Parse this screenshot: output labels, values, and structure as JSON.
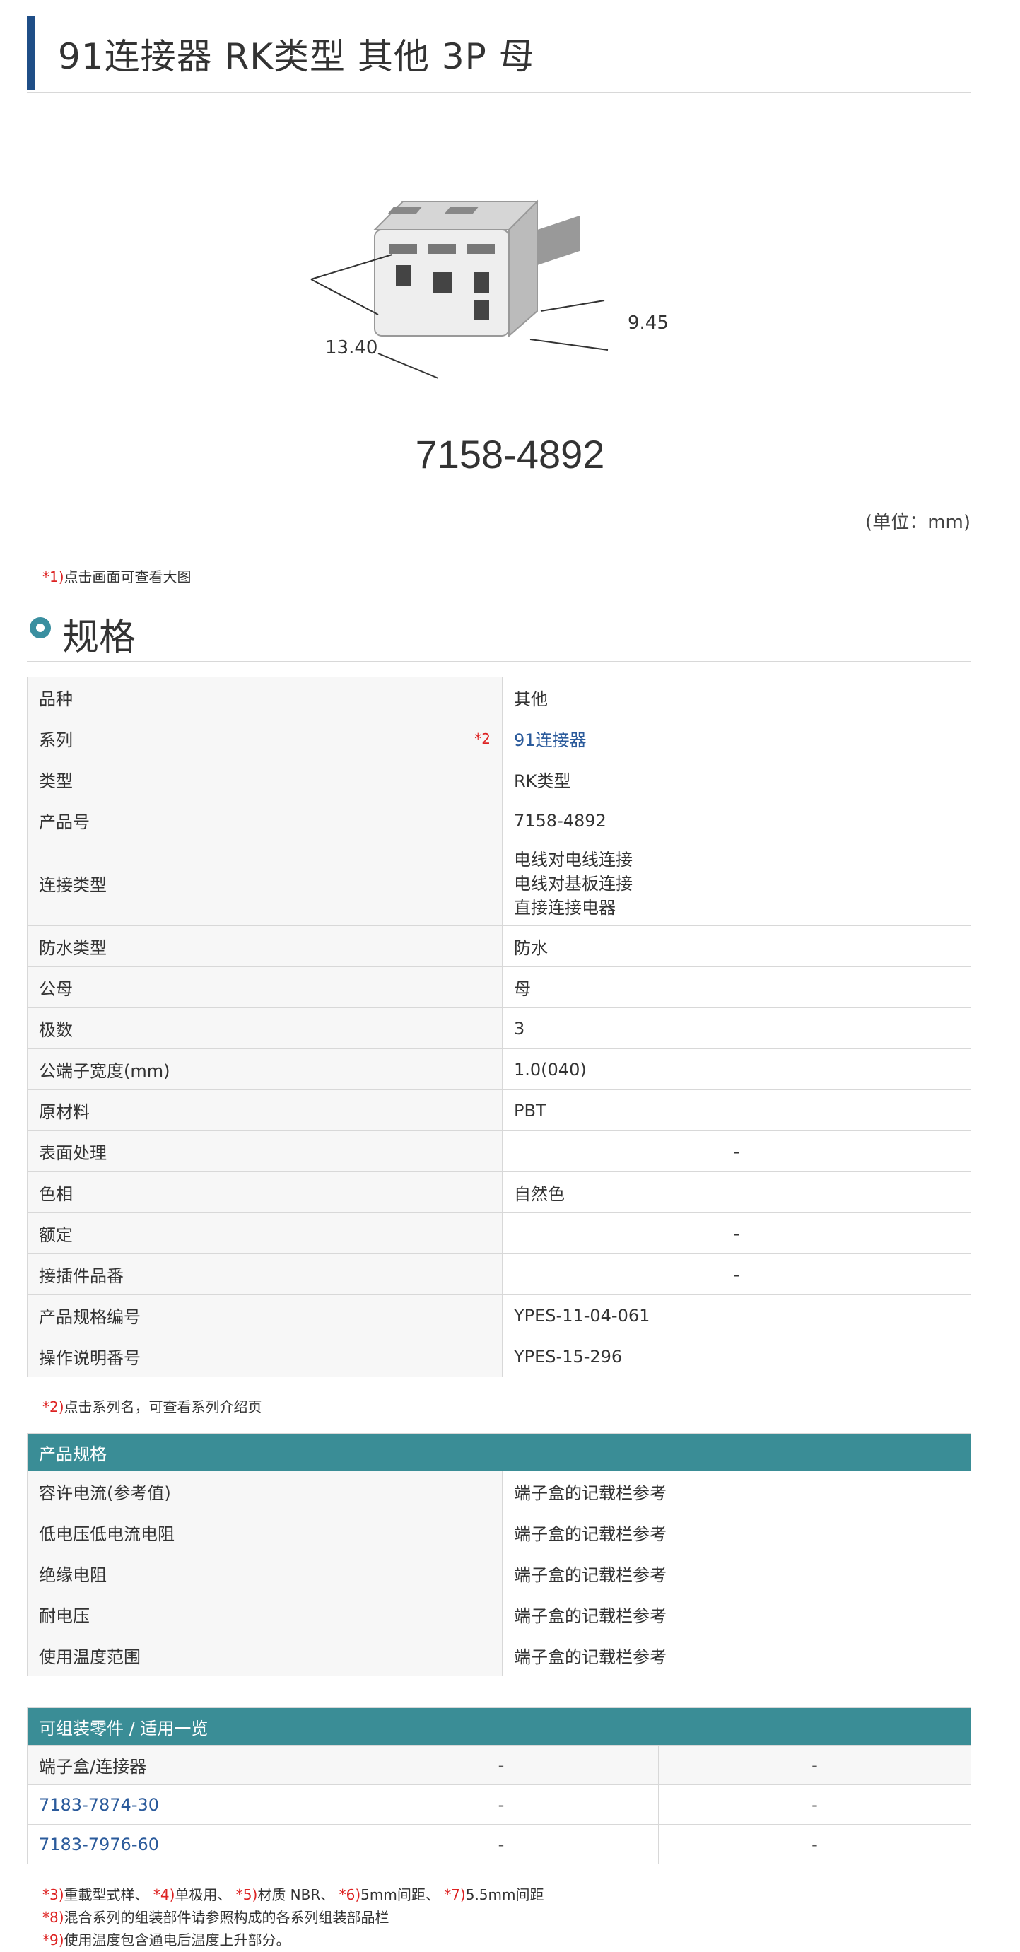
{
  "page_title": "91连接器 RK类型 其他 3P 母",
  "image": {
    "dim_width": "13.40",
    "dim_depth": "9.45"
  },
  "part_number": "7158-4892",
  "unit_note": "(单位：mm)",
  "note1": {
    "mark": "*1)",
    "text": "点击画面可查看大图"
  },
  "spec_heading": "规格",
  "spec_rows": [
    {
      "label": "品种",
      "value": "其他"
    },
    {
      "label": "系列",
      "ref": "*2",
      "value": "91连接器",
      "link": true
    },
    {
      "label": "类型",
      "value": "RK类型"
    },
    {
      "label": "产品号",
      "value": "7158-4892"
    },
    {
      "label": "连接类型",
      "value_lines": [
        "电线对电线连接",
        "电线对基板连接",
        "直接连接电器"
      ]
    },
    {
      "label": "防水类型",
      "value": "防水"
    },
    {
      "label": "公母",
      "value": "母"
    },
    {
      "label": "极数",
      "value": "3"
    },
    {
      "label": "公端子宽度(mm)",
      "value": "1.0(040)"
    },
    {
      "label": "原材料",
      "value": "PBT"
    },
    {
      "label": "表面处理",
      "value": "-",
      "center": true
    },
    {
      "label": "色相",
      "value": "自然色"
    },
    {
      "label": "额定",
      "value": "-",
      "center": true
    },
    {
      "label": "接插件品番",
      "value": "-",
      "center": true
    },
    {
      "label": "产品规格编号",
      "value": "YPES-11-04-061"
    },
    {
      "label": "操作说明番号",
      "value": "YPES-15-296"
    }
  ],
  "note2": {
    "mark": "*2)",
    "text": "点击系列名，可查看系列介绍页"
  },
  "product_spec": {
    "title": "产品规格",
    "rows": [
      {
        "label": "容许电流(参考值)",
        "value": "端子盒的记载栏参考"
      },
      {
        "label": "低电压低电流电阻",
        "value": "端子盒的记载栏参考"
      },
      {
        "label": "绝缘电阻",
        "value": "端子盒的记载栏参考"
      },
      {
        "label": "耐电压",
        "value": "端子盒的记载栏参考"
      },
      {
        "label": "使用温度范围",
        "value": "端子盒的记载栏参考"
      }
    ]
  },
  "assembly": {
    "title": "可组装零件 / 适用一览",
    "header": {
      "label": "端子盒/连接器",
      "col2": "-",
      "col3": "-"
    },
    "rows": [
      {
        "part": "7183-7874-30",
        "col2": "-",
        "col3": "-"
      },
      {
        "part": "7183-7976-60",
        "col2": "-",
        "col3": "-"
      }
    ]
  },
  "footnotes": {
    "line1": [
      {
        "mark": "*3)",
        "text": "重載型式样、 "
      },
      {
        "mark": "*4)",
        "text": "单极用、 "
      },
      {
        "mark": "*5)",
        "text": "材质 NBR、 "
      },
      {
        "mark": "*6)",
        "text": "5mm间距、 "
      },
      {
        "mark": "*7)",
        "text": "5.5mm间距"
      }
    ],
    "line2": {
      "mark": "*8)",
      "text": "混合系列的组装部件请参照构成的各系列组装部品栏"
    },
    "line3": {
      "mark": "*9)",
      "text": "使用温度包含通电后温度上升部分。"
    }
  }
}
